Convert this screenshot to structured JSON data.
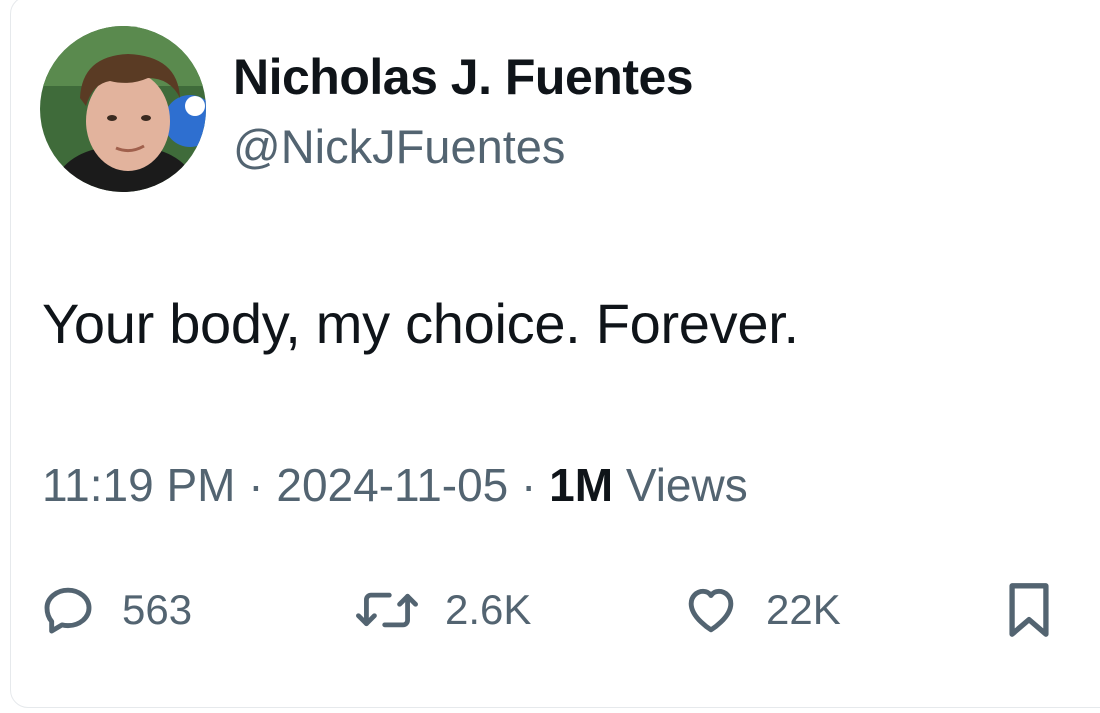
{
  "tweet": {
    "author": {
      "display_name": "Nicholas J. Fuentes",
      "handle": "@NickJFuentes"
    },
    "text": "Your body, my choice. Forever.",
    "meta": {
      "time": "11:19 PM",
      "separator": "·",
      "date": "2024-11-05",
      "views_count": "1M",
      "views_label": "Views"
    },
    "actions": {
      "replies": "563",
      "retweets": "2.6K",
      "likes": "22K"
    }
  },
  "icons": {
    "reply": "speech-bubble-icon",
    "retweet": "retweet-arrows-icon",
    "like": "heart-icon",
    "bookmark": "bookmark-icon"
  },
  "colors": {
    "text_primary": "#0f1419",
    "text_secondary": "#536471",
    "border": "#e6e9ec"
  }
}
